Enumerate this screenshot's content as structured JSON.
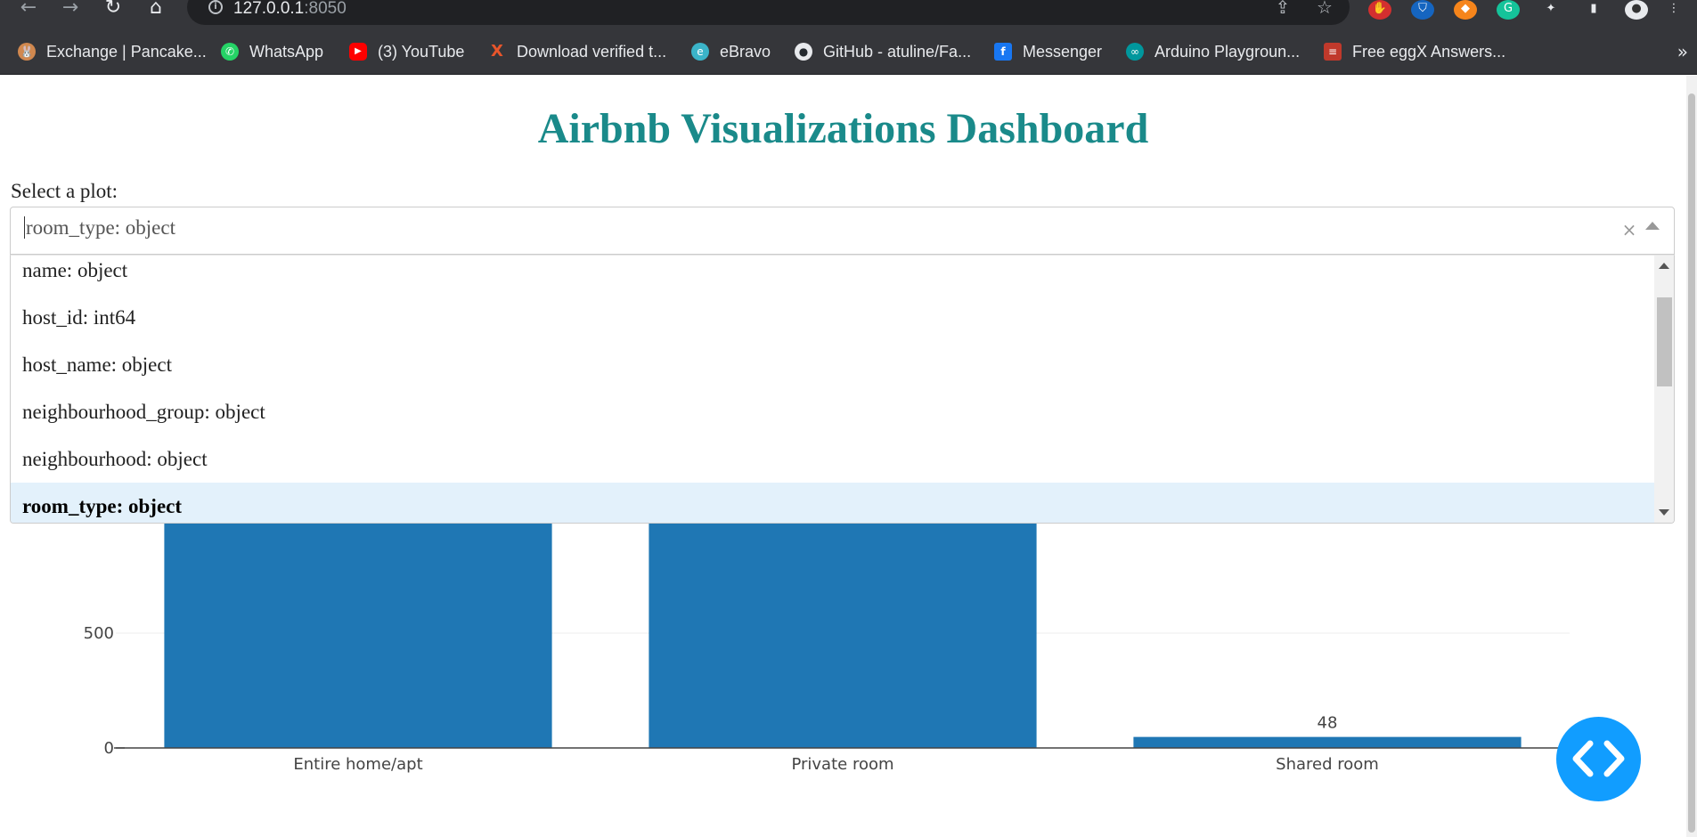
{
  "browser": {
    "url_host": "127.0.0.1",
    "url_port": ":8050",
    "bookmarks": [
      {
        "label": "Exchange | Pancake...",
        "icon": "pancakeswap-icon",
        "color": "#d1884f"
      },
      {
        "label": "WhatsApp",
        "icon": "whatsapp-icon",
        "color": "#25d366"
      },
      {
        "label": "(3) YouTube",
        "icon": "youtube-icon",
        "color": "#ff0000"
      },
      {
        "label": "Download verified t...",
        "icon": "x-logo-icon",
        "color": "#e8552b"
      },
      {
        "label": "eBravo",
        "icon": "ebravo-icon",
        "color": "#3bb4c9"
      },
      {
        "label": "GitHub - atuline/Fa...",
        "icon": "github-icon",
        "color": "#e8eaed"
      },
      {
        "label": "Messenger",
        "icon": "facebook-icon",
        "color": "#1877f2"
      },
      {
        "label": "Arduino Playgroun...",
        "icon": "arduino-icon",
        "color": "#00979d"
      },
      {
        "label": "Free eggX Answers...",
        "icon": "books-icon",
        "color": "#c0392b"
      }
    ],
    "more_label": "»"
  },
  "page": {
    "title": "Airbnb Visualizations Dashboard",
    "plot_label": "Select a plot:"
  },
  "dropdown": {
    "value": "room_type: object",
    "options": [
      "name: object",
      "host_id: int64",
      "host_name: object",
      "neighbourhood_group: object",
      "neighbourhood: object",
      "room_type: object"
    ],
    "selected_index": 5
  },
  "chart_data": {
    "type": "bar",
    "categories": [
      "Entire home/apt",
      "Private room",
      "Shared room"
    ],
    "values": [
      null,
      null,
      48
    ],
    "value_labels": [
      "",
      "",
      "48"
    ],
    "ylim_visible": [
      0,
      1000
    ],
    "y_ticks": [
      0,
      500
    ],
    "color": "#1f77b4"
  },
  "colors": {
    "title": "#1a8a8a",
    "bar": "#1f77b4",
    "selected_option_bg": "#e3f1fb",
    "fab": "#119dff"
  }
}
